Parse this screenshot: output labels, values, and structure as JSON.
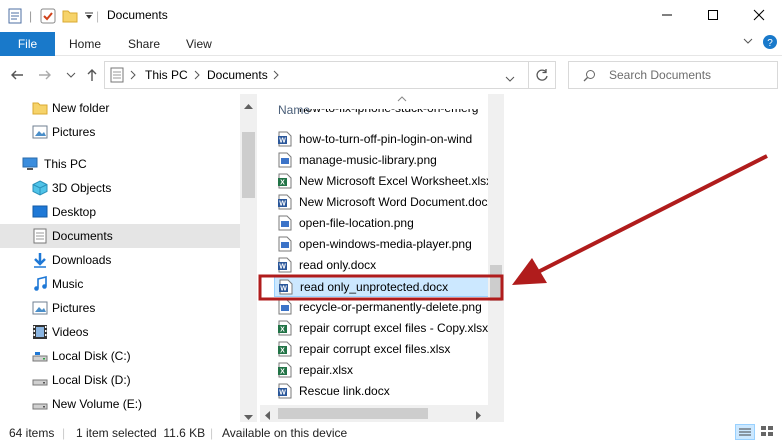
{
  "window": {
    "title": "Documents"
  },
  "ribbon": {
    "file": "File",
    "home": "Home",
    "share": "Share",
    "view": "View"
  },
  "address": {
    "segments": [
      "This PC",
      "Documents"
    ]
  },
  "search": {
    "placeholder": "Search Documents"
  },
  "nav": {
    "items": [
      {
        "label": "New folder",
        "icon": "folder-icon"
      },
      {
        "label": "Pictures",
        "icon": "pictures-icon"
      },
      {
        "label": "This PC",
        "icon": "this-pc-icon"
      },
      {
        "label": "3D Objects",
        "icon": "3d-objects-icon"
      },
      {
        "label": "Desktop",
        "icon": "desktop-icon"
      },
      {
        "label": "Documents",
        "icon": "documents-icon",
        "selected": true
      },
      {
        "label": "Downloads",
        "icon": "downloads-icon"
      },
      {
        "label": "Music",
        "icon": "music-icon"
      },
      {
        "label": "Pictures",
        "icon": "pictures-icon"
      },
      {
        "label": "Videos",
        "icon": "videos-icon"
      },
      {
        "label": "Local Disk (C:)",
        "icon": "drive-icon"
      },
      {
        "label": "Local Disk (D:)",
        "icon": "drive-icon"
      },
      {
        "label": "New Volume (E:)",
        "icon": "drive-icon"
      }
    ]
  },
  "files": {
    "column_name": "Name",
    "partial_top": "how-to-fix-iphone-stuck-on-emerg",
    "items": [
      {
        "name": "how-to-turn-off-pin-login-on-wind",
        "type": "word"
      },
      {
        "name": "manage-music-library.png",
        "type": "png"
      },
      {
        "name": "New Microsoft Excel Worksheet.xlsx",
        "type": "excel"
      },
      {
        "name": "New Microsoft Word Document.docx",
        "type": "word"
      },
      {
        "name": "open-file-location.png",
        "type": "png"
      },
      {
        "name": "open-windows-media-player.png",
        "type": "png"
      },
      {
        "name": "read only.docx",
        "type": "word"
      },
      {
        "name": "read only_unprotected.docx",
        "type": "word",
        "selected": true
      },
      {
        "name": "recycle-or-permanently-delete.png",
        "type": "png"
      },
      {
        "name": "repair corrupt excel files - Copy.xlsx",
        "type": "excel"
      },
      {
        "name": "repair corrupt excel files.xlsx",
        "type": "excel"
      },
      {
        "name": "repair.xlsx",
        "type": "excel"
      },
      {
        "name": "Rescue link.docx",
        "type": "word"
      }
    ]
  },
  "status": {
    "count": "64 items",
    "selection": "1 item selected  11.6 KB",
    "availability": "Available on this device"
  },
  "colors": {
    "accent": "#1979ca",
    "selection_bg": "#cce8ff",
    "annotation": "#b01c1c",
    "word": "#2b579a",
    "excel": "#217346"
  }
}
